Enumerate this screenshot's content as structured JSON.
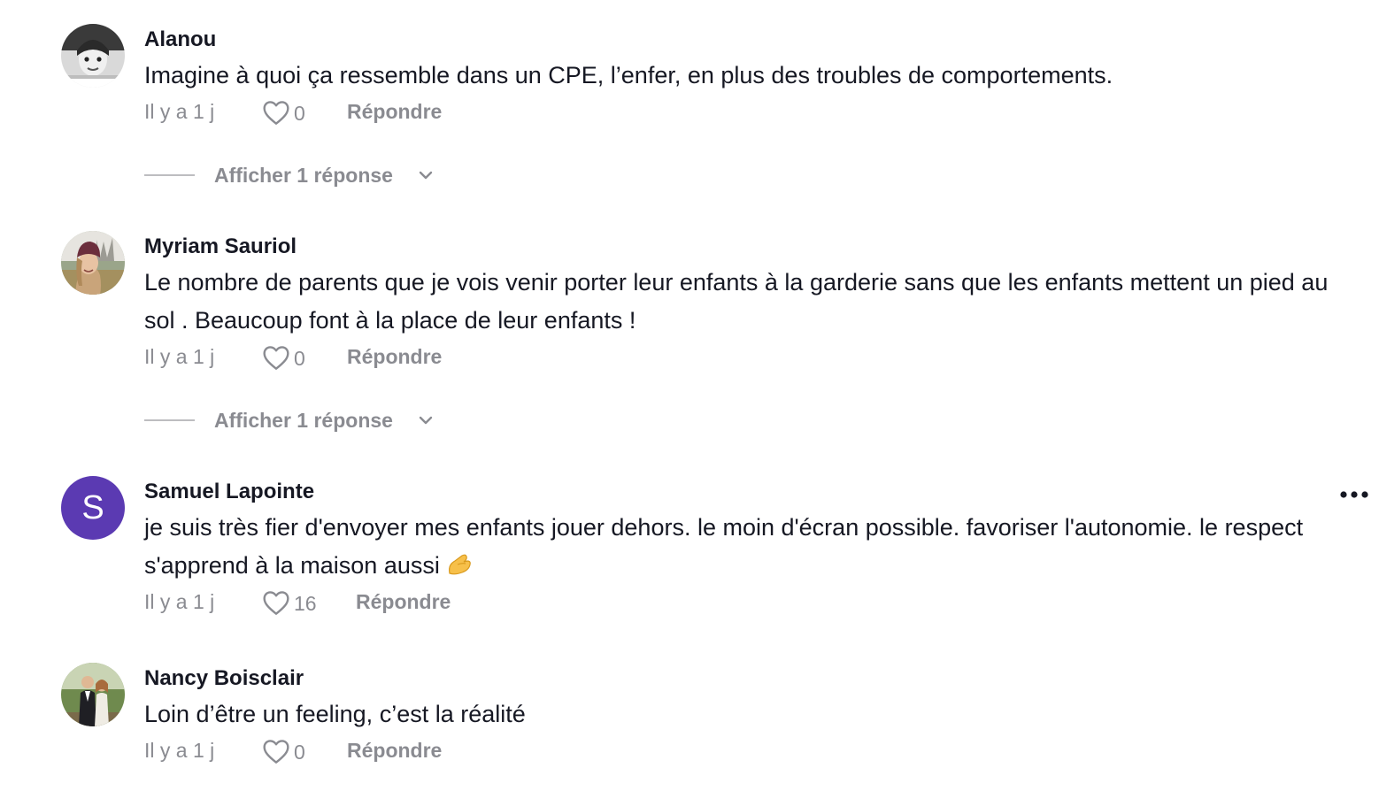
{
  "comments": [
    {
      "username": "Alanou",
      "avatar": "photo",
      "text": "Imagine à quoi ça ressemble dans un CPE, l’enfer, en plus des troubles de comportements.",
      "time": "Il y a 1 j",
      "likes": "0",
      "reply_label": "Répondre",
      "view_replies": "Afficher 1 réponse"
    },
    {
      "username": "Myriam Sauriol",
      "avatar": "photo",
      "text": "Le nombre de parents que je vois venir porter leur enfants à la garderie sans que les enfants mettent un pied au sol . Beaucoup font à la place de leur enfants !",
      "time": "Il y a 1 j",
      "likes": "0",
      "reply_label": "Répondre",
      "view_replies": "Afficher 1 réponse"
    },
    {
      "username": "Samuel Lapointe",
      "avatar_letter": "S",
      "avatar_color": "#5b3ab2",
      "text": "je suis très fier d'envoyer mes enfants jouer dehors. le moin d'écran possible. favoriser l'autonomie. le respect s'apprend à la maison aussi",
      "emoji": "pinching-hand-emoji",
      "time": "Il y a 1 j",
      "likes": "16",
      "reply_label": "Répondre"
    },
    {
      "username": "Nancy Boisclair",
      "avatar": "photo",
      "text": "Loin d’être un feeling, c’est la réalité",
      "time": "Il y a 1 j",
      "likes": "0",
      "reply_label": "Répondre"
    }
  ],
  "icons": {
    "like": "heart-outline-icon",
    "more": "more-options-icon",
    "expand": "chevron-down-icon"
  },
  "colors": {
    "text": "#161823",
    "meta": "#8a8b91",
    "avatar_s": "#5b3ab2"
  }
}
